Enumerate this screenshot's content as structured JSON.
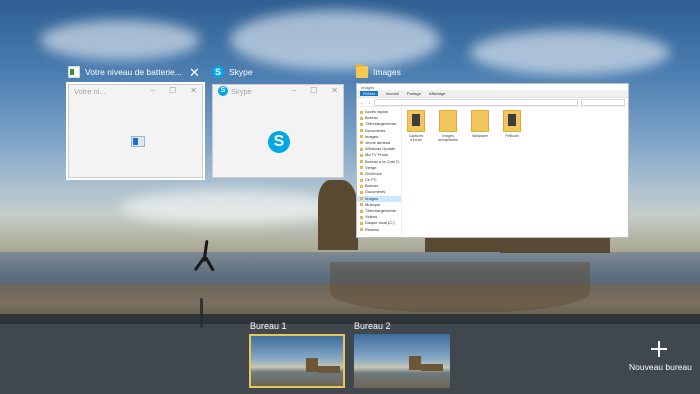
{
  "task_view": {
    "windows": [
      {
        "title": "Votre niveau de batterie...",
        "inner_title": "Votre ni..."
      },
      {
        "title": "Skype",
        "inner_title": "Skype"
      },
      {
        "title": "Images"
      }
    ]
  },
  "explorer_preview": {
    "title": "Images",
    "ribbon_tabs": [
      "Fichier",
      "Accueil",
      "Partage",
      "Affichage"
    ],
    "nav_items": [
      "Accès rapide",
      "Bureau",
      "Téléchargements",
      "Documents",
      "Images",
      "Jeune airhead",
      "Windows Update",
      "Ma TV Photo",
      "Bureau à la Cote D.",
      "Vierge",
      "OneDrive",
      "Ce PC",
      "Bureau",
      "Documents",
      "Images",
      "Musique",
      "Téléchargements",
      "Vidéos",
      "Disque local (C:)",
      "Réseau"
    ],
    "files": [
      {
        "name": "Captures d'écran",
        "style": "dark"
      },
      {
        "name": "Images enregistrées",
        "style": "plain"
      },
      {
        "name": "Wallpaper",
        "style": "plain"
      },
      {
        "name": "Pellicule",
        "style": "dark"
      }
    ]
  },
  "virtual_desktops": {
    "desktops": [
      {
        "label": "Bureau 1",
        "active": true
      },
      {
        "label": "Bureau 2",
        "active": false
      }
    ],
    "new_desktop_label": "Nouveau bureau"
  },
  "colors": {
    "accent_active_desktop": "#e7c65a",
    "skype_blue": "#00a8e6",
    "explorer_file_tab": "#1979ca"
  }
}
